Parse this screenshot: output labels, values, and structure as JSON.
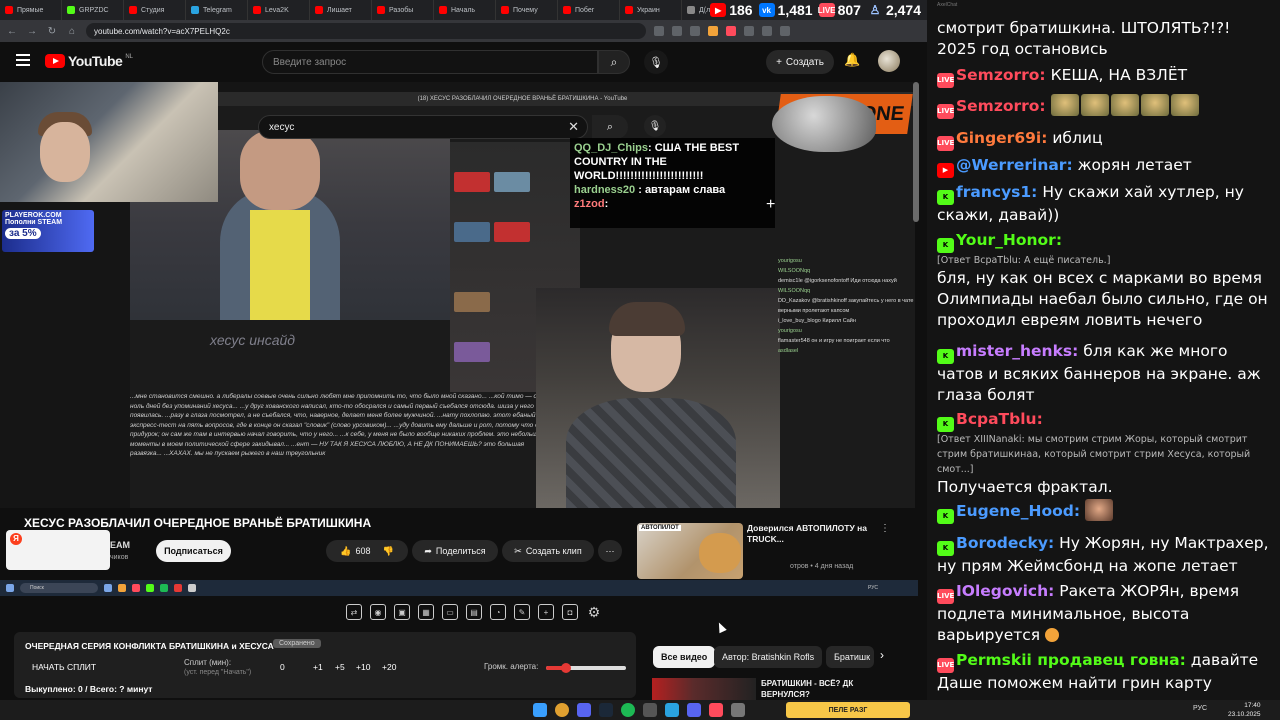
{
  "browser": {
    "tabs": [
      "Прямые",
      "GRPZDC",
      "Студия",
      "Telegram",
      "Leva2K",
      "Лишает",
      "Разобы",
      "Началь",
      "Почему",
      "Побег",
      "Украин",
      "Д(лра"
    ],
    "url": "youtube.com/watch?v=acX7PELHQ2c"
  },
  "viewer_counts": [
    {
      "platform": "youtube",
      "value": "186"
    },
    {
      "platform": "vk",
      "value": "1,481"
    },
    {
      "platform": "vk-live",
      "value": "807"
    },
    {
      "platform": "total",
      "value": "2,474"
    }
  ],
  "youtube": {
    "logo": "YouTube",
    "region": "NL",
    "search_placeholder": "Введите запрос",
    "create_label": "Создать",
    "video": {
      "inner_tab_title": "(18) ХЕСУС РАЗОБЛАЧИЛ ОЧЕРЕДНОЕ ВРАНЬЁ БРАТИШКИНА - YouTube",
      "inner_search": "хесус",
      "overlay_chat": [
        {
          "user": "QQ_DJ_Chips",
          "text": ": США THE BEST COUNTRY IN THE WORLD!!!!!!!!!!!!!!!!!!!!!!!!"
        },
        {
          "user": "hardness20",
          "text": ": автарам слава"
        },
        {
          "user": "z1zod",
          "text": ":"
        }
      ],
      "insayd": "хесус инсайд",
      "transcript": "...мне становится смешно. а либералы соевые очень сильно любят мне припомнить то, что было мной сказано... ...кой тимо — о, ноль дней без упоминаний хесуса... ...у друг хованского написал, кто-то обосрался и самый первый съебался отсюда. шиза у него появилась. ...разу в глаза посмотрел, а не съебался, что, наверное, делает меня более мужчиной. ...нату похлопаю. этот ебаный экспресс-тест на пять вопросов, где в конце он сказал \"словик\" (слово урсовиком)... ...уду довить ему дальше и рот, потому что он придурок; он сам же там в интервью начал говорить, что у него... ...к себе, у меня не было вообще никаких проблем. это небольшие моменты в моем политической сфере закидывал... ...ент — НУ ТАК Я ХЕСУСА ЛЮБЛЮ, А НЕ ДК ПОНИМАЕШЬ? это большая развязка... ...ХАХАХ. мы не пускаем рыжего в наш треугольник",
      "right_overlay_chat": [
        "yourigosu",
        "WILSOONqq",
        "demisc1le @igorksenofontoff Иди отсюда нахуй",
        "WILSOONqq",
        "DD_Kazakov @bratishkinoff закупайтесь у него в чате верными пролетают капсом",
        "i_love_buy_blogo Кирилл Сайн",
        "yourigosu",
        "flamaster548 он и игру не поиграет если что",
        "asdlasel"
      ],
      "brand": "ONE"
    },
    "title": "ХЕСУС РАЗОБЛАЧИЛ ОЧЕРЕДНОЕ ВРАНЬЁ БРАТИШКИНА",
    "channel_name": "EAM",
    "channel_subs": "чиков",
    "subscribe_label": "Подписаться",
    "likes": "608",
    "share_label": "Поделиться",
    "clip_label": "Создать клип",
    "recommendation": {
      "thumb_label": "АВТОПИЛОТ",
      "title": "Доверился АВТОПИЛОТУ на TRUCK...",
      "meta": "отров • 4 дня назад"
    },
    "chips": [
      "Все видео",
      "Автор: Bratishkin Rofls",
      "Братишк"
    ],
    "rec2_title_line1": "БРАТИШКИН - ВСЁ? ДК",
    "rec2_title_line2": "ВЕРНУЛСЯ?"
  },
  "mini_taskbar": {
    "search": "Поиск",
    "lang": "РУС"
  },
  "split_panel": {
    "title": "ОЧЕРЕДНАЯ СЕРИЯ КОНФЛИКТА БРАТИШКИНА и ХЕСУСА",
    "badge": "Сохранено",
    "start_label": "НАЧАТЬ СПЛИТ",
    "split_label": "Сплит (мин):",
    "split_hint": "(уст. перед \"Начать\")",
    "values": [
      "0",
      "+1",
      "+5",
      "+10",
      "+20"
    ],
    "alert_label": "Громк. алерта:",
    "alert_level": 0.25,
    "status": "Выкуплено: 0 / Всего: ? минут"
  },
  "chat": {
    "app_title": "AxelChat",
    "messages": [
      {
        "platform": "none",
        "user": "",
        "user_color": "#ffffff",
        "reply": "",
        "text": "смотрит братишкина. ШТОЛЯТЬ?!?! 2025 год остановись"
      },
      {
        "platform": "vk",
        "user": "Semzorro:",
        "user_color": "#ff4b5c",
        "reply": "",
        "text": "КЕША, НА ВЗЛЁТ"
      },
      {
        "platform": "vk",
        "user": "Semzorro:",
        "user_color": "#ff4b5c",
        "reply": "",
        "text": ""
      },
      {
        "platform": "vk",
        "user": "Ginger69i:",
        "user_color": "#ff7a3d",
        "reply": "",
        "text": "иблиц"
      },
      {
        "platform": "yt",
        "user": "@Werrerinar:",
        "user_color": "#4b9bff",
        "reply": "",
        "text": "жорян летает"
      },
      {
        "platform": "kick",
        "user": "francys1:",
        "user_color": "#4b9bff",
        "reply": "",
        "text": "Ну скажи хай хутлер, ну скажи, давай))"
      },
      {
        "platform": "kick",
        "user": "Your_Honor:",
        "user_color": "#53fc18",
        "reply": "[Ответ ВсраTblu: А ещё писатель.]",
        "text": "бля, ну как он всех с марками во время Олимпиады наебал было сильно, где он проходил евреям ловить нечего"
      },
      {
        "platform": "kick",
        "user": "mister_henks:",
        "user_color": "#c77dff",
        "reply": "",
        "text": "бля как же много чатов и всяких баннеров на экране. аж глаза болят"
      },
      {
        "platform": "kick",
        "user": "ВсраTblu:",
        "user_color": "#ff4b5c",
        "reply": "[Ответ XIIINanaki: мы смотрим стрим Жоры, который смотрит стрим братишкинаа, который смотрит стрим Хесуса, который смот...]",
        "text": "Получается фрактал."
      },
      {
        "platform": "kick",
        "user": "Eugene_Hood:",
        "user_color": "#4b9bff",
        "reply": "",
        "text": ""
      },
      {
        "platform": "kick",
        "user": "Borodecky:",
        "user_color": "#4b9bff",
        "reply": "",
        "text": "Ну Жорян, ну Мактрахер, ну прям Жеймсбонд на жопе летает"
      },
      {
        "platform": "vk",
        "user": "IOlegovich:",
        "user_color": "#c77dff",
        "reply": "",
        "text": "Ракета ЖОРЯн, время подлета минимальное, высота варьируется"
      },
      {
        "platform": "vk",
        "user": "Permskii продавец говна:",
        "user_color": "#53fc18",
        "reply": "",
        "text": "давайте Даше поможем найти грин карту"
      }
    ]
  },
  "taskbar": {
    "center_label": "ПЕЛЕ РАЗГ",
    "lang": "РУС",
    "time": "17:40",
    "date": "23.10.2025"
  },
  "colors": {
    "accent": "#ff0000",
    "chat_bg": "#141414",
    "yt_bg": "#0f0f0f"
  }
}
